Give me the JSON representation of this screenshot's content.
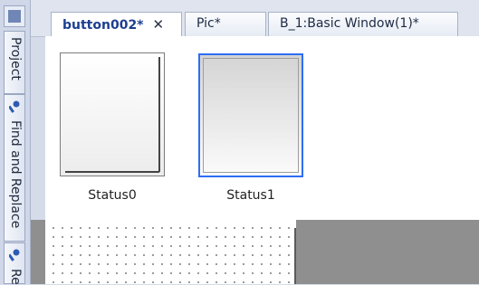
{
  "side_panel": {
    "icons": [
      "panel-icon",
      "wrench-icon",
      "wrench-icon"
    ],
    "tabs": [
      "Project",
      "Find and Replace",
      "Re"
    ]
  },
  "tabs": [
    {
      "label": "button002*",
      "active": true,
      "close_glyph": "✕"
    },
    {
      "label": "Pic*",
      "active": false
    },
    {
      "label": "B_1:Basic Window(1)*",
      "active": false
    }
  ],
  "states": [
    {
      "label": "Status0",
      "selected": false
    },
    {
      "label": "Status1",
      "selected": true
    }
  ],
  "colors": {
    "selection": "#2e6df5",
    "canvas_bg": "#8f8f8f"
  }
}
